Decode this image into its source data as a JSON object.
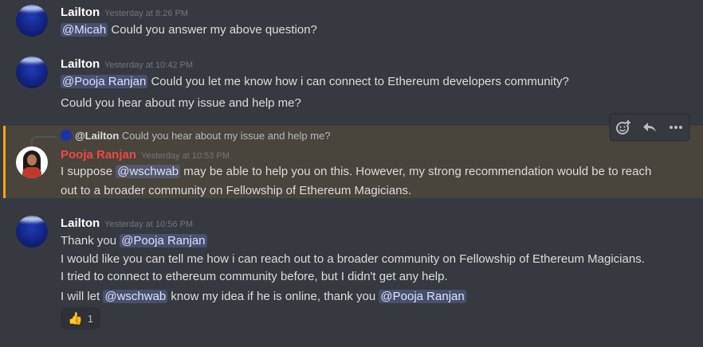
{
  "messages": [
    {
      "author": "Lailton",
      "timestamp": "Yesterday at 8:26 PM",
      "line1": {
        "mention": "@Micah",
        "text": " Could you answer my above question?"
      }
    },
    {
      "author": "Lailton",
      "timestamp": "Yesterday at 10:42 PM",
      "line1": {
        "mention": "@Pooja Ranjan",
        "text": "  Could you let me know how i can connect to Ethereum developers community?"
      },
      "line2": "Could you hear about my issue and help me?"
    },
    {
      "author": "Pooja Ranjan",
      "author_color": "#f04747",
      "timestamp": "Yesterday at 10:53 PM",
      "reply_to": {
        "name": "@Lailton",
        "text": "Could you hear about my issue and help me?"
      },
      "line1": {
        "pre": "I suppose ",
        "mention": "@wschwab",
        "text": " may be able to help you on this. However, my strong recommendation would be to reach"
      },
      "line2": "out to a broader community on Fellowship of Ethereum Magicians."
    },
    {
      "author": "Lailton",
      "timestamp": "Yesterday at 10:56 PM",
      "line1": {
        "pre": "Thank you ",
        "mention": "@Pooja Ranjan"
      },
      "line2": "I would like you can tell me how i can reach out to a broader community on Fellowship of Ethereum Magicians.",
      "line3": "I tried to connect to ethereum community before, but I didn't get any help.",
      "line4": {
        "pre": "I will let ",
        "mention": "@wschwab",
        "mid": " know my idea if he is online, thank you ",
        "mention2": "@Pooja Ranjan"
      },
      "reaction": {
        "emoji": "👍",
        "count": "1"
      }
    }
  ],
  "toolbar": {
    "icons": [
      "add-reaction-icon",
      "reply-icon",
      "more-icon"
    ]
  },
  "colors": {
    "background": "#36393f",
    "highlight": "#49443c",
    "highlight_border": "#faa61a",
    "mention_bg": "#4e5486"
  }
}
